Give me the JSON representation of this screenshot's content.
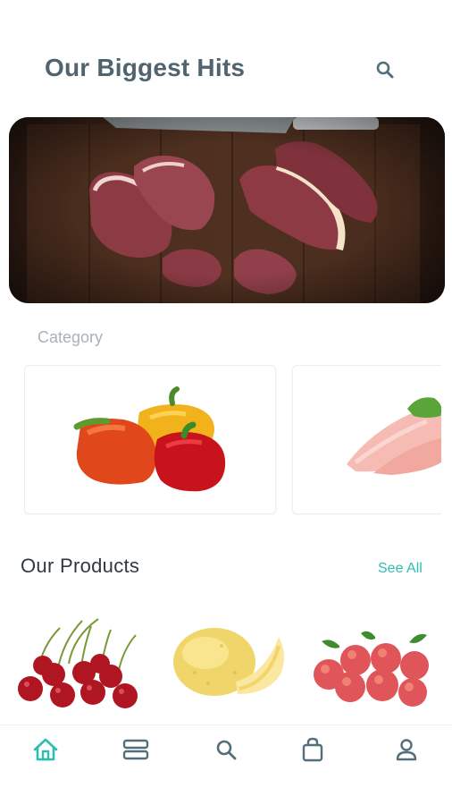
{
  "header": {
    "title": "Our Biggest Hits"
  },
  "hero": {
    "subject": "raw steak cuts on wooden board"
  },
  "category": {
    "label": "Category",
    "items": [
      {
        "name": "bell-peppers"
      },
      {
        "name": "chicken-breast"
      }
    ]
  },
  "products": {
    "title": "Our Products",
    "see_all": "See All",
    "items": [
      {
        "name": "cherries"
      },
      {
        "name": "melon"
      },
      {
        "name": "peaches"
      }
    ]
  },
  "nav": {
    "items": [
      {
        "icon": "home-icon",
        "active": true
      },
      {
        "icon": "list-icon",
        "active": false
      },
      {
        "icon": "search-icon",
        "active": false
      },
      {
        "icon": "bag-icon",
        "active": false
      },
      {
        "icon": "profile-icon",
        "active": false
      }
    ]
  },
  "colors": {
    "accent": "#2ebdb1",
    "title": "#4f6470",
    "muted": "#a7b3b9",
    "nav_icon": "#546e7a"
  }
}
